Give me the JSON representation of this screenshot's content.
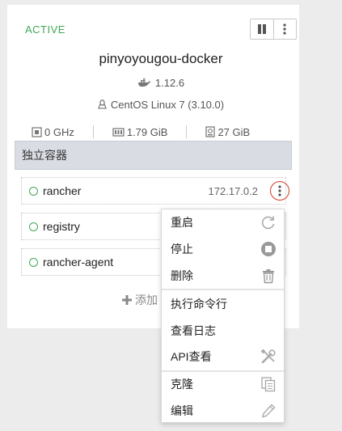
{
  "host": {
    "status": "ACTIVE",
    "name": "pinyoyougou-docker",
    "docker_version": "1.12.6",
    "os": "CentOS Linux 7 (3.10.0)",
    "cpu": "0 GHz",
    "memory": "1.79 GiB",
    "storage": "27 GiB"
  },
  "section": {
    "title": "独立容器",
    "add_label": "添加"
  },
  "containers": [
    {
      "name": "rancher",
      "ip": "172.17.0.2"
    },
    {
      "name": "registry",
      "ip": ""
    },
    {
      "name": "rancher-agent",
      "ip": ""
    }
  ],
  "menu": {
    "items": [
      {
        "label": "重启",
        "icon": "restart-icon"
      },
      {
        "label": "停止",
        "icon": "stop-icon"
      },
      {
        "label": "删除",
        "icon": "trash-icon"
      },
      {
        "label": "执行命令行",
        "icon": ""
      },
      {
        "label": "查看日志",
        "icon": ""
      },
      {
        "label": "API查看",
        "icon": "tools-icon"
      },
      {
        "label": "克隆",
        "icon": "clone-icon"
      },
      {
        "label": "编辑",
        "icon": "pencil-icon"
      }
    ]
  },
  "colors": {
    "active": "#41a755",
    "highlight": "#d43a2a",
    "section_bg": "#d9dde3"
  }
}
